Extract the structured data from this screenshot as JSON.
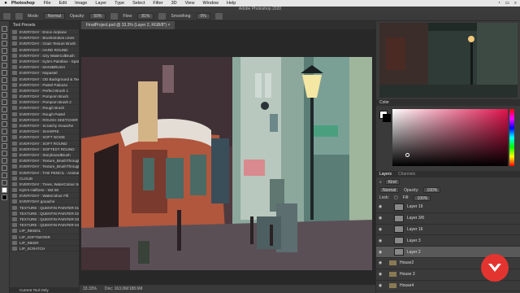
{
  "menubar": {
    "apple": "",
    "app_name": "Photoshop",
    "items": [
      "File",
      "Edit",
      "Image",
      "Layer",
      "Type",
      "Select",
      "Filter",
      "3D",
      "View",
      "Window",
      "Help"
    ]
  },
  "window": {
    "title": "Adobe Photoshop 2020"
  },
  "options": {
    "mode_label": "Mode:",
    "mode_value": "Normal",
    "opacity_label": "Opacity:",
    "opacity_value": "50%",
    "flow_label": "Flow:",
    "flow_value": "81%",
    "smoothing_label": "Smoothing:",
    "smoothing_value": "0%"
  },
  "presets": {
    "tab": "Tool Presets",
    "items": [
      "EVERYDAY : Ersce Airplane",
      "EVERYDAY : Brushstrokes Lines",
      "EVERYDAY : Grain Texture Brush",
      "EVERYDAY : HARD ROUND",
      "EVERYDAY : Izzy WatercolBrush",
      "EVERYDAY : Kyle's Paintbox - Spat...",
      "EVERYDAY : MANIBRUSH",
      "EVERYDAY : Nopastel",
      "EVERYDAY : OD Background & Text...",
      "EVERYDAY : Pastel Palooza",
      "EVERYDAY : Perfect Brush 1",
      "EVERYDAY : Pompom Brush",
      "EVERYDAY : Pompom Brush 2",
      "EVERYDAY : Rough Brush",
      "EVERYDAY : Rough Pastel",
      "EVERYDAY : ROUGH SKETCHER",
      "EVERYDAY : Scratchy Gouache",
      "EVERYDAY : SHARPIE",
      "EVERYDAY : SOFT NOISE",
      "EVERYDAY : SOFT ROUND",
      "EVERYDAY : SOFTEST ROUND",
      "EVERYDAY : StoryboardBrush",
      "EVERYDAY : Texture_BrushThrough",
      "EVERYDAY : Texture_BrushThrough...",
      "EVERYDAY : THE PENCIL - Animat...",
      "CLOUD",
      "EVERYDAY : Trees, WaterColour Soft",
      "Kyle's Halftone - WZ 50",
      "EVERYDAY : Watercolour Fill",
      "EVERYDAY gouache",
      "TEXTURE : QUENTIN PAINTER 01",
      "TEXTURE : QUENTIN PAINTER 02",
      "TEXTURE : QUENTIN PAINTER 03",
      "TEXTURE : QUENTIN PAINTER 04",
      "LIP_INKBOL",
      "LIP_SOFTWATER",
      "LIP_INKER",
      "LIP_SCRATCH"
    ],
    "footer": "Current Tool Only"
  },
  "document": {
    "tab_label": "FinalProject.psd @ 33.3% (Layer 2, RGB/8*)",
    "close": "×"
  },
  "status": {
    "zoom": "33.33%",
    "doc": "Doc: 163.0M/188.6M"
  },
  "color_panel": {
    "title": "Color"
  },
  "layers_panel": {
    "tabs": [
      "Layers",
      "Channels"
    ],
    "kind_label": "Kind",
    "blend_mode": "Normal",
    "opacity_label": "Opacity:",
    "opacity_value": "100%",
    "lock_label": "Lock:",
    "fill_label": "Fill:",
    "fill_value": "100%",
    "layers": [
      {
        "name": "Layer 19",
        "type": "layer",
        "selected": false
      },
      {
        "name": "Layer 3/8",
        "type": "layer",
        "selected": false
      },
      {
        "name": "Layer 16",
        "type": "layer",
        "selected": false
      },
      {
        "name": "Layer 3",
        "type": "layer",
        "selected": false
      },
      {
        "name": "Layer 2",
        "type": "layer",
        "selected": true
      },
      {
        "name": "House2",
        "type": "folder",
        "selected": false
      },
      {
        "name": "House 3",
        "type": "folder",
        "selected": false
      },
      {
        "name": "House4",
        "type": "folder",
        "selected": false
      }
    ]
  },
  "colors": {
    "accent": "#e3342f",
    "selected_row": "#2d4f7a"
  }
}
